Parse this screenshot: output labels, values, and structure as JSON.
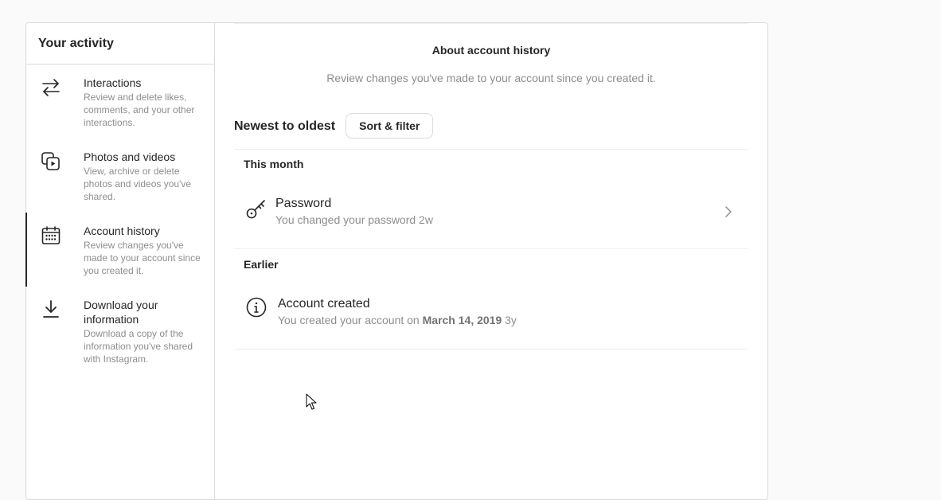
{
  "sidebar": {
    "title": "Your activity",
    "items": [
      {
        "label": "Interactions",
        "desc": "Review and delete likes, comments, and your other interactions.",
        "icon": "arrows-swap-icon",
        "active": false
      },
      {
        "label": "Photos and videos",
        "desc": "View, archive or delete photos and videos you've shared.",
        "icon": "photos-videos-icon",
        "active": false
      },
      {
        "label": "Account history",
        "desc": "Review changes you've made to your account since you created it.",
        "icon": "calendar-icon",
        "active": true
      },
      {
        "label": "Download your information",
        "desc": "Download a copy of the information you've shared with Instagram.",
        "icon": "download-icon",
        "active": false
      }
    ]
  },
  "main": {
    "about_title": "About account history",
    "about_desc": "Review changes you've made to your account since you created it.",
    "sort_label": "Newest to oldest",
    "sort_button": "Sort & filter",
    "sections": [
      {
        "label": "This month",
        "entries": [
          {
            "title": "Password",
            "subtitle": "You changed your password 2w",
            "icon": "key-icon",
            "has_chevron": true
          }
        ]
      },
      {
        "label": "Earlier",
        "entries": [
          {
            "title": "Account created",
            "subtitle_prefix": "You created your account on",
            "subtitle_date": "March 14, 2019",
            "subtitle_suffix": "3y",
            "icon": "info-icon",
            "has_chevron": false
          }
        ]
      }
    ]
  },
  "colors": {
    "text_primary": "#262626",
    "text_secondary": "#8e8e8e",
    "border": "#dbdbdb",
    "background": "#fafafa"
  }
}
